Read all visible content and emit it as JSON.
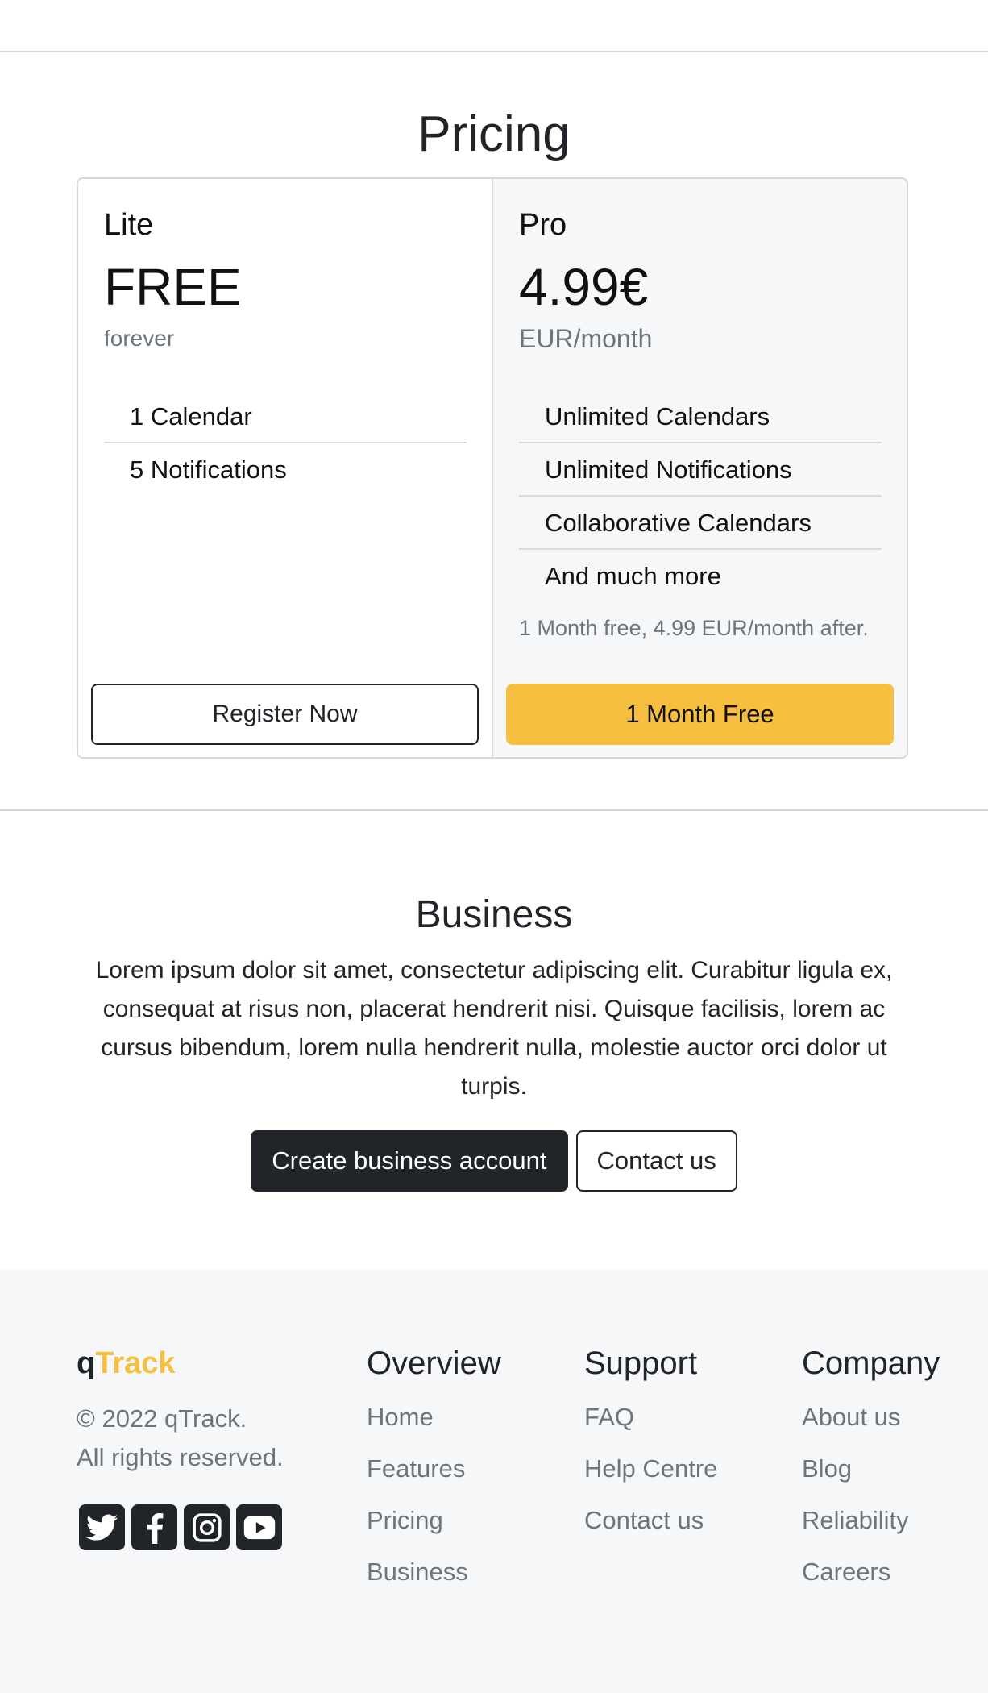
{
  "pricing": {
    "title": "Pricing",
    "plans": [
      {
        "name": "Lite",
        "price": "FREE",
        "period": "forever",
        "features": [
          "1 Calendar",
          "5 Notifications"
        ],
        "note": "",
        "button": "Register Now"
      },
      {
        "name": "Pro",
        "price": "4.99€",
        "period": "EUR/month",
        "features": [
          "Unlimited Calendars",
          "Unlimited Notifications",
          "Collaborative Calendars",
          "And much more"
        ],
        "note": "1 Month free, 4.99 EUR/month after.",
        "button": "1 Month Free"
      }
    ]
  },
  "business": {
    "title": "Business",
    "text": "Lorem ipsum dolor sit amet, consectetur adipiscing elit. Curabitur ligula ex, consequat at risus non, placerat hendrerit nisi. Quisque facilisis, lorem ac cursus bibendum, lorem nulla hendrerit nulla, molestie auctor orci dolor ut turpis.",
    "primary_button": "Create business account",
    "secondary_button": "Contact us"
  },
  "footer": {
    "brand_q": "q",
    "brand_track": "Track",
    "copyright_line1": "© 2022 qTrack.",
    "copyright_line2": "All rights reserved.",
    "social_icons": [
      "twitter-icon",
      "facebook-icon",
      "instagram-icon",
      "youtube-icon"
    ],
    "columns": [
      {
        "title": "Overview",
        "links": [
          "Home",
          "Features",
          "Pricing",
          "Business"
        ]
      },
      {
        "title": "Support",
        "links": [
          "FAQ",
          "Help Centre",
          "Contact us"
        ]
      },
      {
        "title": "Company",
        "links": [
          "About us",
          "Blog",
          "Reliability",
          "Careers"
        ]
      }
    ]
  },
  "colors": {
    "accent": "#f6bf40",
    "dark": "#212529",
    "muted": "#6c757d",
    "footer_bg": "#f6f7f9"
  }
}
